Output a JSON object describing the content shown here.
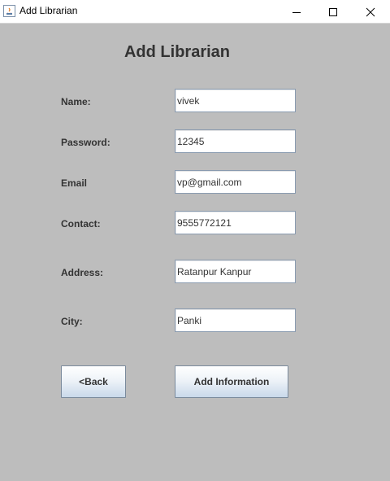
{
  "window": {
    "title": "Add Librarian",
    "icon": "java-app-icon",
    "controls": [
      "minimize-icon",
      "maximize-icon",
      "close-icon"
    ]
  },
  "form": {
    "heading": "Add Librarian",
    "fields": {
      "name": {
        "label": "Name:",
        "value": "vivek"
      },
      "password": {
        "label": "Password:",
        "value": "12345"
      },
      "email": {
        "label": "Email",
        "value": "vp@gmail.com"
      },
      "contact": {
        "label": "Contact:",
        "value": "9555772121"
      },
      "address": {
        "label": "Address:",
        "value": "Ratanpur Kanpur"
      },
      "city": {
        "label": "City:",
        "value": "Panki"
      }
    },
    "buttons": {
      "back": "<Back",
      "add": "Add Information"
    }
  },
  "colors": {
    "background": "#bdbdbd",
    "text": "#333333",
    "field_border": "#8a9bb0"
  }
}
